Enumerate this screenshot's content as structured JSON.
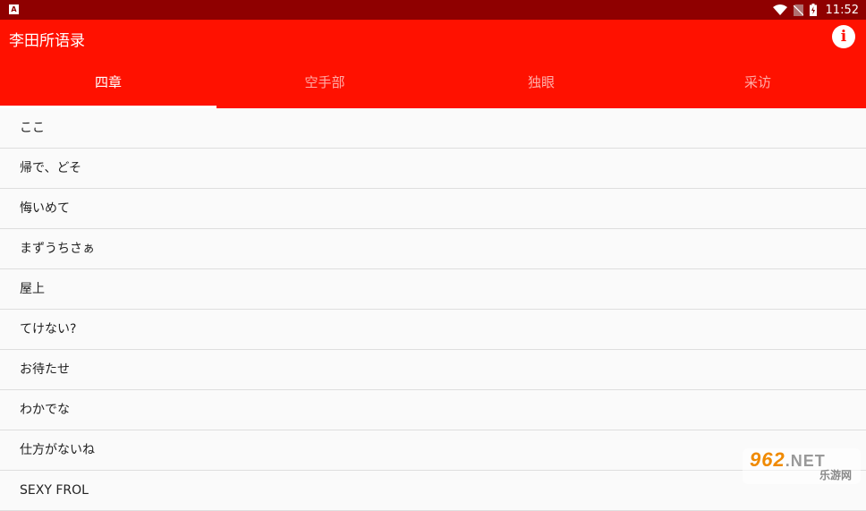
{
  "status_bar": {
    "notification_label": "A",
    "time": "11:52",
    "icons": [
      "wifi-icon",
      "no-sim-icon",
      "battery-charging-icon"
    ]
  },
  "app_bar": {
    "title": "李田所语录",
    "info_icon": "info-icon",
    "info_label": "i"
  },
  "tabs": [
    {
      "label": "四章",
      "active": true
    },
    {
      "label": "空手部",
      "active": false
    },
    {
      "label": "独眼",
      "active": false
    },
    {
      "label": "采访",
      "active": false
    }
  ],
  "list": {
    "items": [
      "ここ",
      "帰で、どそ",
      "悔いめて",
      "まずうちさぁ",
      "屋上",
      "てけない?",
      "お待たせ",
      "わかでな",
      "仕方がないね",
      "SEXY FROL"
    ]
  },
  "watermark": {
    "brand": "962",
    "suffix": ".NET",
    "sub": "乐游网"
  },
  "colors": {
    "status_bar": "#8f0000",
    "app_bar": "#ff1100",
    "background": "#fafafa",
    "divider": "#dedede"
  }
}
